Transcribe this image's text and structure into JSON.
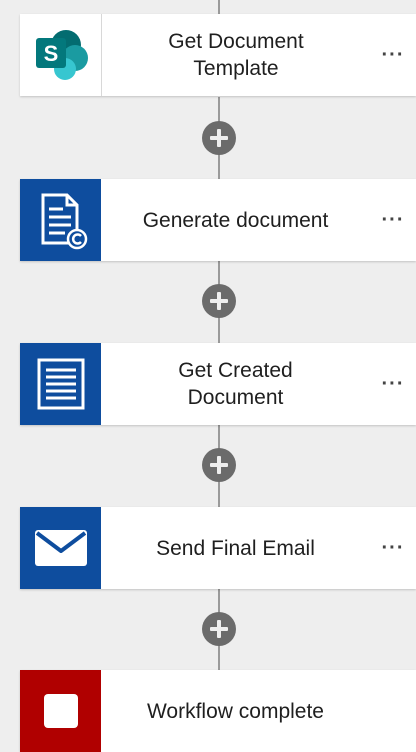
{
  "workflow": {
    "steps": [
      {
        "title": "Get Document\nTemplate",
        "icon": "sharepoint-icon",
        "icon_bg": "#ffffff",
        "more": "···"
      },
      {
        "title": "Generate document",
        "icon": "document-generate-icon",
        "icon_bg": "#0e4d9e",
        "more": "···"
      },
      {
        "title": "Get Created\nDocument",
        "icon": "document-lines-icon",
        "icon_bg": "#0e4d9e",
        "more": "···"
      },
      {
        "title": "Send Final Email",
        "icon": "envelope-icon",
        "icon_bg": "#0e4d9e",
        "more": "···"
      },
      {
        "title": "Workflow complete",
        "icon": "stop-square-icon",
        "icon_bg": "#b00000",
        "more": ""
      }
    ]
  },
  "colors": {
    "background": "#eeeeee",
    "connector": "#9a9a9a",
    "add_button": "#6b6b6b",
    "action_blue": "#0e4d9e",
    "stop_red": "#b00000",
    "sharepoint_teal": "#036c70"
  }
}
